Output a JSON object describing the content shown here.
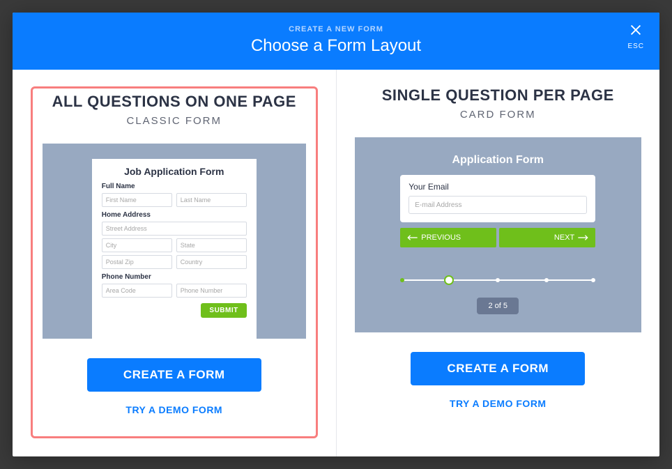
{
  "header": {
    "kicker": "CREATE A NEW FORM",
    "title": "Choose a Form Layout",
    "close_label": "ESC"
  },
  "options": [
    {
      "title": "ALL QUESTIONS ON ONE PAGE",
      "subtitle": "CLASSIC FORM",
      "create_label": "CREATE A FORM",
      "demo_label": "TRY A DEMO FORM",
      "preview": {
        "form_title": "Job Application Form",
        "full_name_label": "Full Name",
        "first_name_ph": "First Name",
        "last_name_ph": "Last Name",
        "home_address_label": "Home Address",
        "street_ph": "Street Address",
        "city_ph": "City",
        "state_ph": "State",
        "postal_ph": "Postal Zip",
        "country_ph": "Country",
        "phone_label": "Phone Number",
        "area_ph": "Area Code",
        "phone_ph": "Phone Number",
        "submit_label": "SUBMIT"
      }
    },
    {
      "title": "SINGLE QUESTION PER PAGE",
      "subtitle": "CARD FORM",
      "create_label": "CREATE A FORM",
      "demo_label": "TRY A DEMO FORM",
      "preview": {
        "form_title": "Application Form",
        "field_label": "Your Email",
        "field_ph": "E-mail Address",
        "prev_label": "PREVIOUS",
        "next_label": "NEXT",
        "progress_label": "2 of 5"
      }
    }
  ]
}
